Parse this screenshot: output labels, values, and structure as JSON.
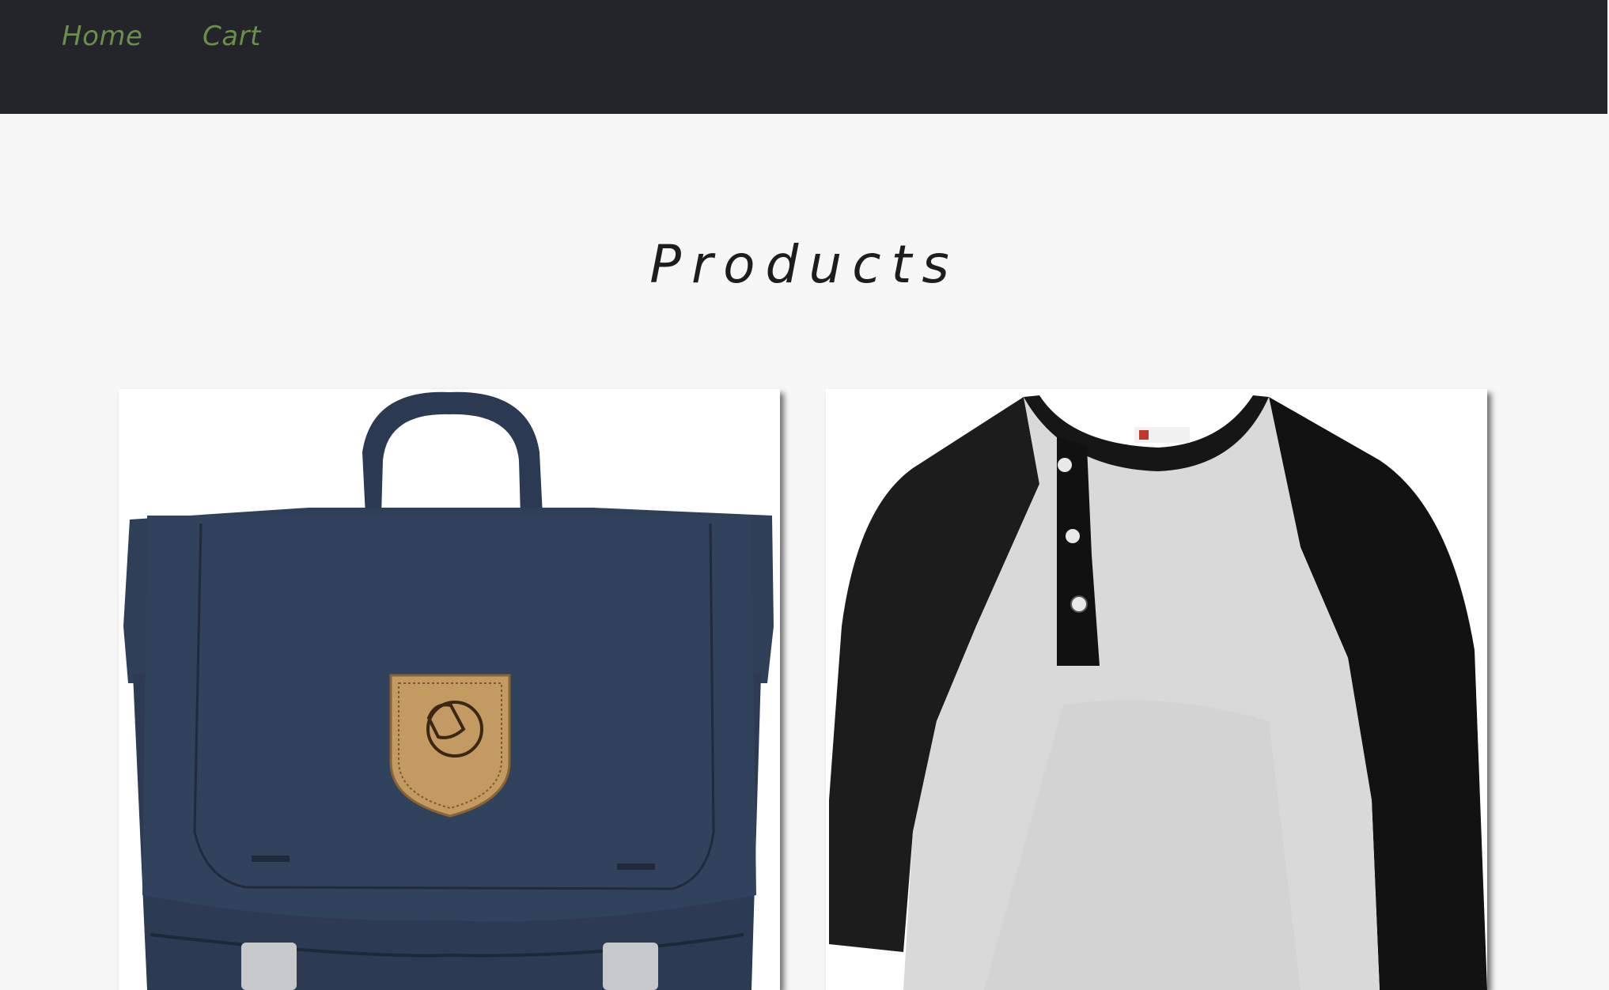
{
  "nav": {
    "home_label": "Home",
    "cart_label": "Cart"
  },
  "page": {
    "title": "Products"
  },
  "products": [
    {
      "image": "navy-backpack"
    },
    {
      "image": "raglan-henley-shirt"
    }
  ],
  "colors": {
    "navbar_bg": "#24252b",
    "nav_link": "#6b8f4b",
    "page_bg": "#f7f7f7",
    "backpack_navy": "#2e3d55",
    "leather_patch": "#c49a63",
    "shirt_heather": "#d9d9d9",
    "shirt_black": "#151515"
  }
}
